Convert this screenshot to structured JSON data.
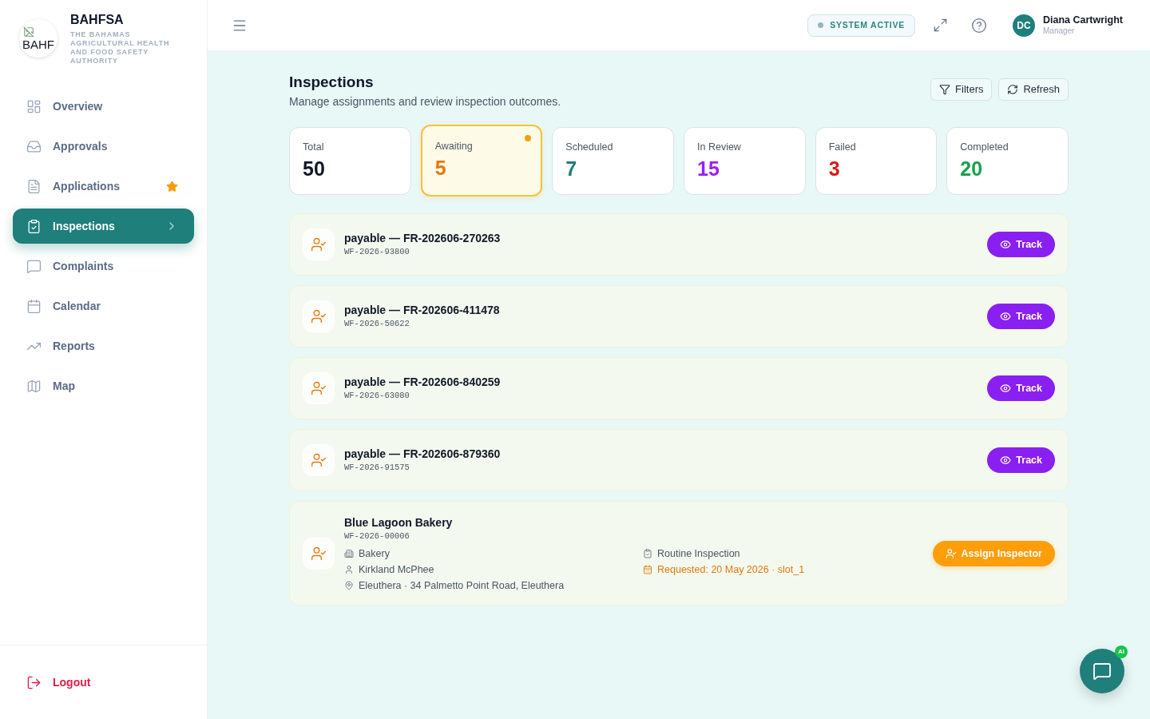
{
  "sidebar": {
    "logo": {
      "alt_text": "BAHF"
    },
    "brand": {
      "name": "BAHFSA",
      "subtitle": "THE BAHAMAS AGRICULTURAL HEALTH AND FOOD SAFETY AUTHORITY"
    },
    "items": [
      {
        "label": "Overview",
        "selected": false,
        "starred": false
      },
      {
        "label": "Approvals",
        "selected": false,
        "starred": false
      },
      {
        "label": "Applications",
        "selected": false,
        "starred": true
      },
      {
        "label": "Inspections",
        "selected": true,
        "starred": false
      },
      {
        "label": "Complaints",
        "selected": false,
        "starred": false
      },
      {
        "label": "Calendar",
        "selected": false,
        "starred": false
      },
      {
        "label": "Reports",
        "selected": false,
        "starred": false
      },
      {
        "label": "Map",
        "selected": false,
        "starred": false
      }
    ],
    "logout": "Logout"
  },
  "header": {
    "status": "SYSTEM ACTIVE",
    "user": {
      "initials": "DC",
      "name": "Diana Cartwright",
      "role": "Manager"
    }
  },
  "page": {
    "title": "Inspections",
    "subtitle": "Manage assignments and review inspection outcomes.",
    "buttons": [
      "Filters",
      "Refresh"
    ]
  },
  "stats": [
    {
      "label": "Total",
      "value": "50",
      "color": "#111827",
      "selected": false
    },
    {
      "label": "Awaiting",
      "value": "5",
      "color": "#e2780c",
      "selected": true
    },
    {
      "label": "Scheduled",
      "value": "7",
      "color": "#1e7f7b",
      "selected": false
    },
    {
      "label": "In Review",
      "value": "15",
      "color": "#9d1ff0",
      "selected": false
    },
    {
      "label": "Failed",
      "value": "3",
      "color": "#e11515",
      "selected": false
    },
    {
      "label": "Completed",
      "value": "20",
      "color": "#16a34a",
      "selected": false
    }
  ],
  "inspections": [
    {
      "kind": "tracked",
      "title": "payable — FR-202606-270263",
      "code": "WF-2026-93800",
      "action": "Track"
    },
    {
      "kind": "tracked",
      "title": "payable — FR-202606-411478",
      "code": "WF-2026-50622",
      "action": "Track"
    },
    {
      "kind": "tracked",
      "title": "payable — FR-202606-840259",
      "code": "WF-2026-63080",
      "action": "Track"
    },
    {
      "kind": "tracked",
      "title": "payable — FR-202606-879360",
      "code": "WF-2026-91575",
      "action": "Track"
    },
    {
      "kind": "unassigned",
      "title": "Blue Lagoon Bakery",
      "code": "WF-2026-00006",
      "details": [
        {
          "kind": "category",
          "text": "Bakery"
        },
        {
          "kind": "inspection_type",
          "text": "Routine Inspection"
        },
        {
          "kind": "contact",
          "text": "Kirkland McPhee"
        },
        {
          "kind": "requested",
          "text": "Requested: 20 May 2026 · slot_1"
        },
        {
          "kind": "location",
          "text": "Eleuthera · 34 Palmetto Point Road, Eleuthera"
        }
      ],
      "action": "Assign Inspector"
    }
  ],
  "chat": {
    "badge": "AI"
  }
}
